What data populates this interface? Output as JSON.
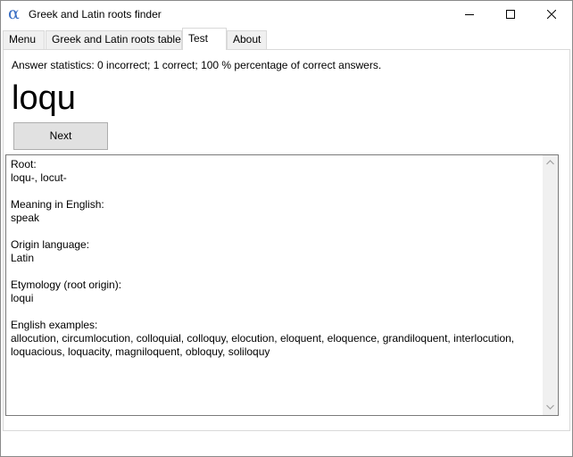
{
  "window": {
    "title": "Greek and Latin roots finder",
    "icon": "alpha-icon",
    "icon_glyph": "α"
  },
  "tabs": [
    {
      "label": "Menu"
    },
    {
      "label": "Greek and Latin roots table"
    },
    {
      "label": "Test"
    },
    {
      "label": "About"
    }
  ],
  "active_tab": "Test",
  "test": {
    "stats": "Answer statistics: 0 incorrect; 1 correct; 100 % percentage of correct answers.",
    "root_word": "loqu",
    "next_label": "Next"
  },
  "info": {
    "root_label": "Root:",
    "root_value": "loqu-, locut-",
    "meaning_label": "Meaning in English:",
    "meaning_value": "speak",
    "origin_label": "Origin language:",
    "origin_value": "Latin",
    "etymology_label": "Etymology (root origin):",
    "etymology_value": "loqui",
    "examples_label": "English examples:",
    "examples_value": "allocution, circumlocution, colloquial, colloquy, elocution, eloquent, eloquence, grandiloquent, interlocution, loquacious, loquacity, magniloquent, obloquy, soliloquy"
  }
}
